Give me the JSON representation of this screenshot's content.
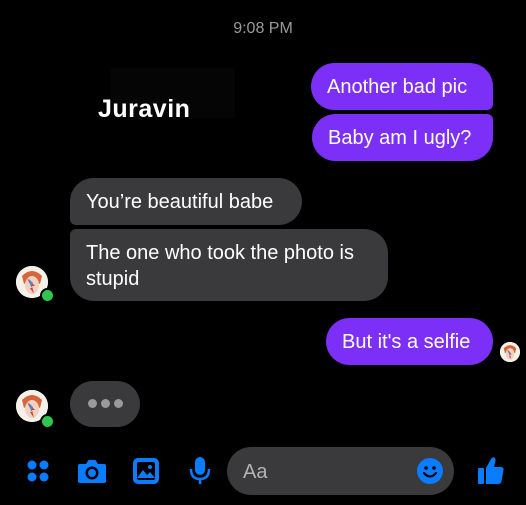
{
  "header": {
    "timestamp": "9:08 PM"
  },
  "watermark": {
    "text": "Juravin"
  },
  "messages": [
    {
      "sender": "me",
      "text": "Another bad pic"
    },
    {
      "sender": "me",
      "text": "Baby am I ugly?"
    },
    {
      "sender": "them",
      "text": "You’re beautiful babe"
    },
    {
      "sender": "them",
      "text": "The one who took the photo is stupid"
    },
    {
      "sender": "me",
      "text": "But it's a selfie"
    }
  ],
  "typing_indicator": {
    "visible": true
  },
  "composer": {
    "placeholder": "Aa"
  },
  "toolbar": {
    "icons": [
      "menu-grid-icon",
      "camera-icon",
      "gallery-icon",
      "microphone-icon",
      "emoji-icon",
      "thumbs-up-icon"
    ]
  },
  "colors": {
    "background": "#000000",
    "outgoing_bubble": "#7b2ff7",
    "incoming_bubble": "#3a3a3c",
    "accent_blue": "#0a7cff",
    "online_green": "#31c44f"
  }
}
